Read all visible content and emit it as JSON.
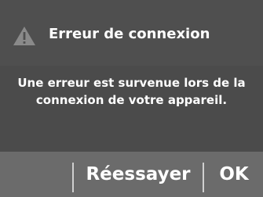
{
  "dialog": {
    "title": "Erreur de connexion",
    "icon": "warning-icon",
    "message_line1": "Une erreur est survenue lors de la",
    "message_line2": "connexion de votre appareil.",
    "buttons": {
      "retry_label": "Réessayer",
      "ok_label": "OK"
    }
  },
  "colors": {
    "dialog_bg": "#4b4b4b",
    "footer_bg": "#6b6b6b",
    "text": "#ffffff",
    "icon_fill": "#8a8a8a"
  }
}
